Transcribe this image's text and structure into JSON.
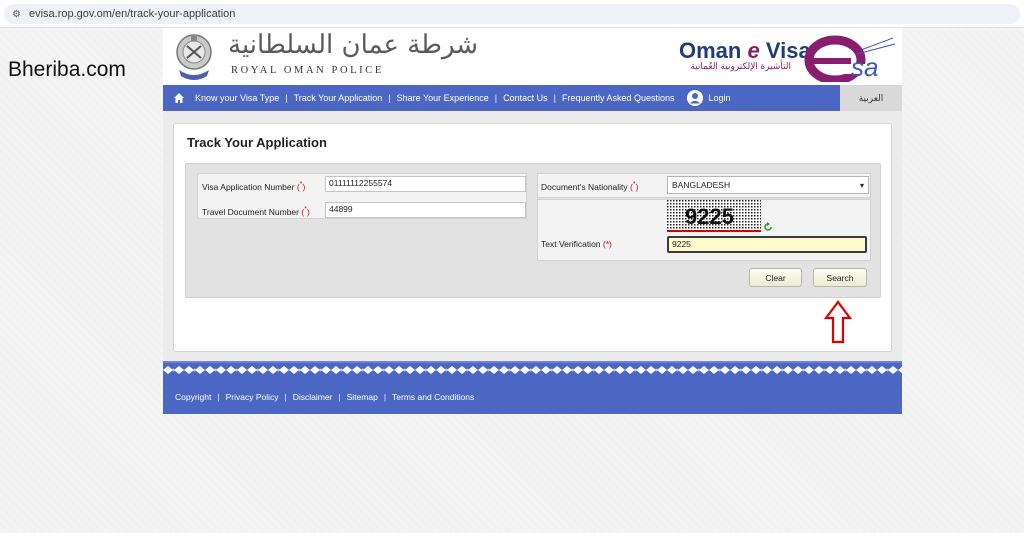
{
  "browser": {
    "url": "evisa.rop.gov.om/en/track-your-application"
  },
  "watermark": "Bheriba.com",
  "header": {
    "rop_arabic": "شرطة عمان السلطانية",
    "rop_english": "ROYAL OMAN POLICE",
    "evisa_title_prefix": "Oman ",
    "evisa_title_e": "e",
    "evisa_title_suffix": " Visa",
    "evisa_arabic": "التأشيرة الإلكترونية العُمانية"
  },
  "nav": {
    "items": [
      "Know your Visa Type",
      "Track Your Application",
      "Share Your Experience",
      "Contact Us",
      "Frequently Asked Questions"
    ],
    "separator": "|",
    "login": "Login",
    "language": "العربية"
  },
  "form": {
    "title": "Track Your Application",
    "visa_number_label": "Visa Application Number",
    "visa_number_value": "01111112255574",
    "travel_doc_label": "Travel Document Number",
    "travel_doc_value": "44899",
    "nationality_label": "Document's Nationality",
    "nationality_value": "BANGLADESH",
    "captcha_text": "9225",
    "verification_label": "Text Verification",
    "verification_value": "9225",
    "required_marker": "(*)",
    "clear_label": "Clear",
    "search_label": "Search"
  },
  "footer": {
    "links": [
      "Copyright",
      "Privacy Policy",
      "Disclaimer",
      "Sitemap",
      "Terms and Conditions"
    ],
    "separator": "|"
  },
  "colors": {
    "nav_blue": "#4c66c4",
    "evisa_purple": "#8b1d6e",
    "required_red": "#e00000",
    "annotation_red": "#e00000"
  }
}
